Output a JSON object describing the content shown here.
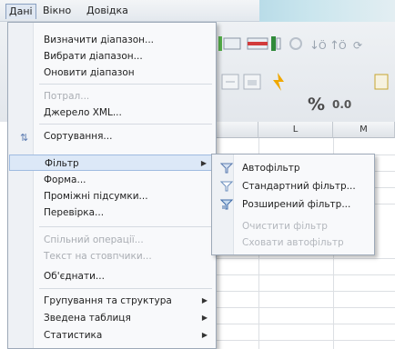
{
  "menubar": {
    "items": [
      {
        "label": "Дані"
      },
      {
        "label": "Вікно"
      },
      {
        "label": "Довідка"
      }
    ]
  },
  "toolbar": {
    "percent_label": "%",
    "decimal_label": "0.0"
  },
  "sheet": {
    "columns": [
      "L",
      "M"
    ]
  },
  "data_menu": {
    "items": [
      {
        "label": "Визначити діапазон...",
        "enabled": true
      },
      {
        "label": "Вибрати діапазон...",
        "enabled": true
      },
      {
        "label": "Оновити діапазон",
        "enabled": true
      },
      {
        "label": "Потрал...",
        "enabled": false
      },
      {
        "label": "Джерело XML...",
        "enabled": true
      },
      {
        "label": "Сортування...",
        "enabled": true
      },
      {
        "label": "Фільтр",
        "enabled": true,
        "submenu": true
      },
      {
        "label": "Форма...",
        "enabled": true
      },
      {
        "label": "Проміжні підсумки...",
        "enabled": true
      },
      {
        "label": "Перевірка...",
        "enabled": true
      },
      {
        "label": "Спільний операції...",
        "enabled": false
      },
      {
        "label": "Текст на стовпчики...",
        "enabled": false
      },
      {
        "label": "Об'єднати...",
        "enabled": true
      },
      {
        "label": "Групування та структура",
        "enabled": true,
        "submenu": true
      },
      {
        "label": "Зведена таблиця",
        "enabled": true,
        "submenu": true
      },
      {
        "label": "Статистика",
        "enabled": true,
        "submenu": true
      }
    ]
  },
  "filter_submenu": {
    "items": [
      {
        "label": "Автофільтр",
        "enabled": true,
        "icon": "autofilter-icon"
      },
      {
        "label": "Стандартний фільтр...",
        "enabled": true,
        "icon": "standard-filter-icon"
      },
      {
        "label": "Розширений фільтр...",
        "enabled": true,
        "icon": "advanced-filter-icon"
      },
      {
        "label": "Очистити фільтр",
        "enabled": false
      },
      {
        "label": "Сховати автофільтр",
        "enabled": false
      }
    ]
  },
  "colors": {
    "highlight": "#dce8f7",
    "menu_bg": "#f8f9fb",
    "border": "#9da9b8"
  }
}
